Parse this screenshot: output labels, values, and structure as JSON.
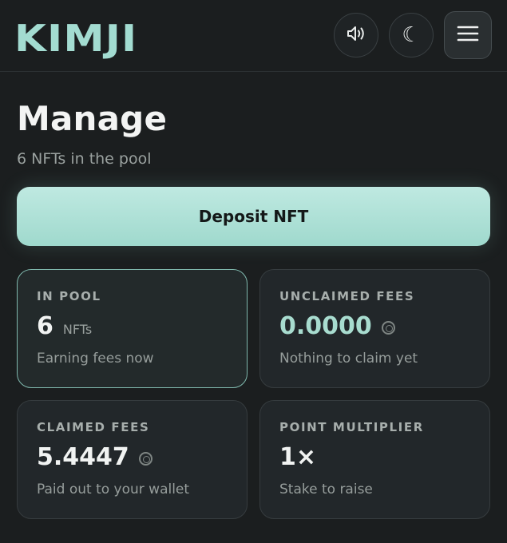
{
  "header": {
    "logo": "KIMJI",
    "sound_icon": "speaker-icon",
    "theme_icon": "moon-icon",
    "menu_icon": "hamburger-icon"
  },
  "page": {
    "title": "Manage",
    "subtitle": "6 NFTs in the pool",
    "deposit_label": "Deposit NFT"
  },
  "cards": [
    {
      "label": "IN POOL",
      "value": "6",
      "unit": "NFTs",
      "desc": "Earning fees now"
    },
    {
      "label": "UNCLAIMED FEES",
      "value": "0.0000",
      "unit_icon": "coin-icon",
      "desc": "Nothing to claim yet"
    },
    {
      "label": "CLAIMED FEES",
      "value": "5.4447",
      "unit_icon": "coin-icon",
      "desc": "Paid out to your wallet"
    },
    {
      "label": "POINT MULTIPLIER",
      "value": "1×",
      "desc": "Stake to raise"
    }
  ],
  "colors": {
    "accent": "#a3dcd1",
    "background": "#1b1e1f",
    "card": "#22272a"
  }
}
